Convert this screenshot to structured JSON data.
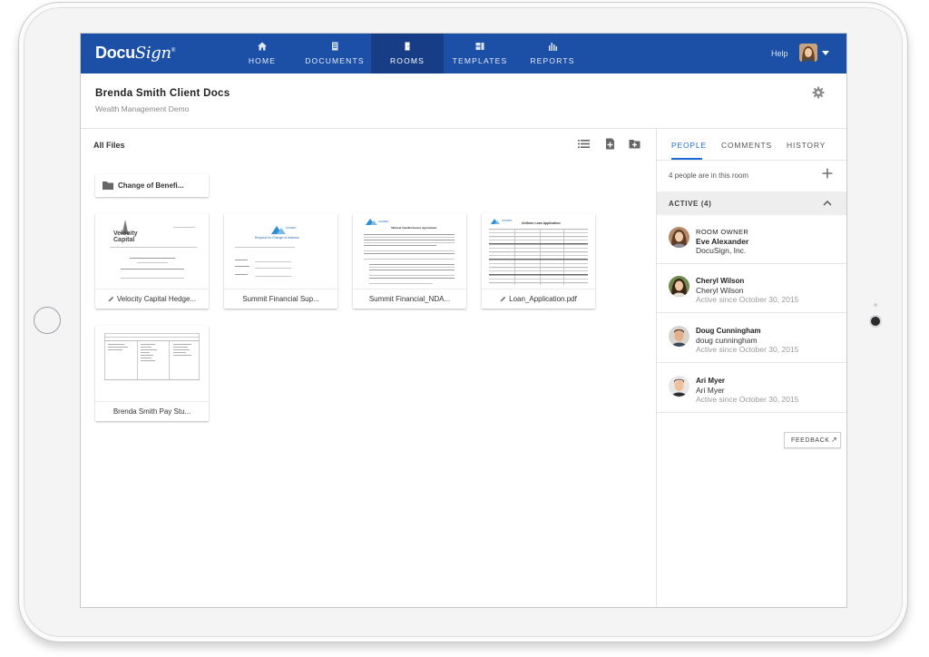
{
  "app": {
    "logo_main": "Docu",
    "logo_italic": "Sign",
    "logo_reg": "®"
  },
  "nav": {
    "items": [
      {
        "label": "HOME",
        "icon": "home-icon"
      },
      {
        "label": "DOCUMENTS",
        "icon": "documents-icon"
      },
      {
        "label": "ROOMS",
        "icon": "rooms-icon"
      },
      {
        "label": "TEMPLATES",
        "icon": "templates-icon"
      },
      {
        "label": "REPORTS",
        "icon": "reports-icon"
      }
    ],
    "active_index": 2,
    "help": "Help"
  },
  "room": {
    "title": "Brenda Smith Client Docs",
    "subtitle": "Wealth Management Demo"
  },
  "files": {
    "heading": "All Files",
    "folder": {
      "label": "Change of Benefi..."
    },
    "items": [
      {
        "label": "Velocity Capital Hedge...",
        "thumb_text_1": "Velocity",
        "thumb_text_2": "Capital"
      },
      {
        "label": "Summit Financial Sup...",
        "thumb_text_1": "SUMMIT",
        "thumb_text_2": "Request for Change of Address"
      },
      {
        "label": "Summit Financial_NDA...",
        "thumb_text_1": "SUMMIT",
        "thumb_text_2": "Mutual Nondisclosure Agreement"
      },
      {
        "label": "Loan_Application.pdf",
        "thumb_text_1": "SUMMIT",
        "thumb_text_2": "Uniform Loan Application"
      },
      {
        "label": "Brenda Smith Pay Stu..."
      }
    ]
  },
  "panel": {
    "tabs": [
      "PEOPLE",
      "COMMENTS",
      "HISTORY"
    ],
    "active_tab": 0,
    "count_text": "4 people are in this room",
    "active_label": "ACTIVE (4)",
    "people": [
      {
        "l1": "ROOM OWNER",
        "l2": "Eve Alexander",
        "l3": "DocuSign, Inc."
      },
      {
        "l1": "Cheryl Wilson",
        "l2": "Cheryl Wilson",
        "l3": "Active since October 30, 2015"
      },
      {
        "l1": "Doug Cunningham",
        "l2": "doug cunningham",
        "l3": "Active since October 30, 2015"
      },
      {
        "l1": "Ari Myer",
        "l2": "Ari Myer",
        "l3": "Active since October 30, 2015"
      }
    ],
    "feedback": "FEEDBACK"
  },
  "colors": {
    "brand": "#1c4fa6",
    "nav_active": "#163d85",
    "accent": "#1c6cd8"
  }
}
